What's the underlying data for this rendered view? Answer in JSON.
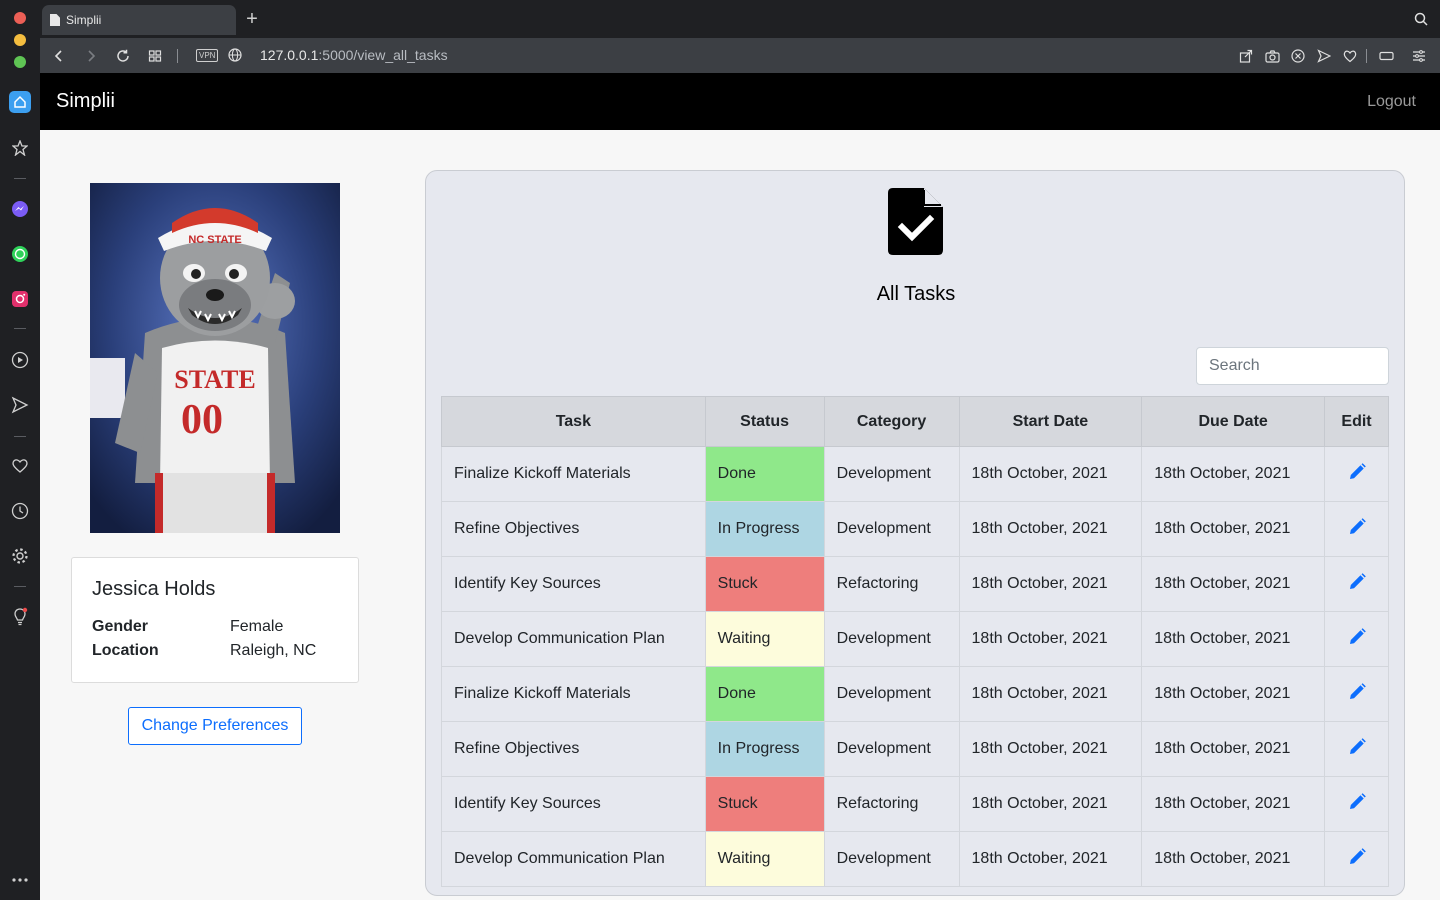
{
  "browser": {
    "tab_title": "Simplii",
    "url_host": "127.0.0.1",
    "url_path": ":5000/view_all_tasks",
    "vpn_label": "VPN"
  },
  "app": {
    "brand": "Simplii",
    "logout": "Logout"
  },
  "profile": {
    "name": "Jessica Holds",
    "fields": [
      {
        "key": "Gender",
        "value": "Female"
      },
      {
        "key": "Location",
        "value": "Raleigh, NC"
      }
    ],
    "change_preferences": "Change Preferences"
  },
  "tasks_panel": {
    "title": "All Tasks",
    "search_placeholder": "Search",
    "columns": [
      "Task",
      "Status",
      "Category",
      "Start Date",
      "Due Date",
      "Edit"
    ],
    "rows": [
      {
        "task": "Finalize Kickoff Materials",
        "status": "Done",
        "category": "Development",
        "start": "18th October, 2021",
        "due": "18th October, 2021"
      },
      {
        "task": "Refine Objectives",
        "status": "In Progress",
        "category": "Development",
        "start": "18th October, 2021",
        "due": "18th October, 2021"
      },
      {
        "task": "Identify Key Sources",
        "status": "Stuck",
        "category": "Refactoring",
        "start": "18th October, 2021",
        "due": "18th October, 2021"
      },
      {
        "task": "Develop Communication Plan",
        "status": "Waiting",
        "category": "Development",
        "start": "18th October, 2021",
        "due": "18th October, 2021"
      },
      {
        "task": "Finalize Kickoff Materials",
        "status": "Done",
        "category": "Development",
        "start": "18th October, 2021",
        "due": "18th October, 2021"
      },
      {
        "task": "Refine Objectives",
        "status": "In Progress",
        "category": "Development",
        "start": "18th October, 2021",
        "due": "18th October, 2021"
      },
      {
        "task": "Identify Key Sources",
        "status": "Stuck",
        "category": "Refactoring",
        "start": "18th October, 2021",
        "due": "18th October, 2021"
      },
      {
        "task": "Develop Communication Plan",
        "status": "Waiting",
        "category": "Development",
        "start": "18th October, 2021",
        "due": "18th October, 2021"
      }
    ]
  },
  "colors": {
    "status_done": "#8fe88a",
    "status_in_progress": "#aed6e3",
    "status_stuck": "#ee7e7c",
    "status_waiting": "#fdfcdc",
    "accent": "#0d6efd"
  }
}
